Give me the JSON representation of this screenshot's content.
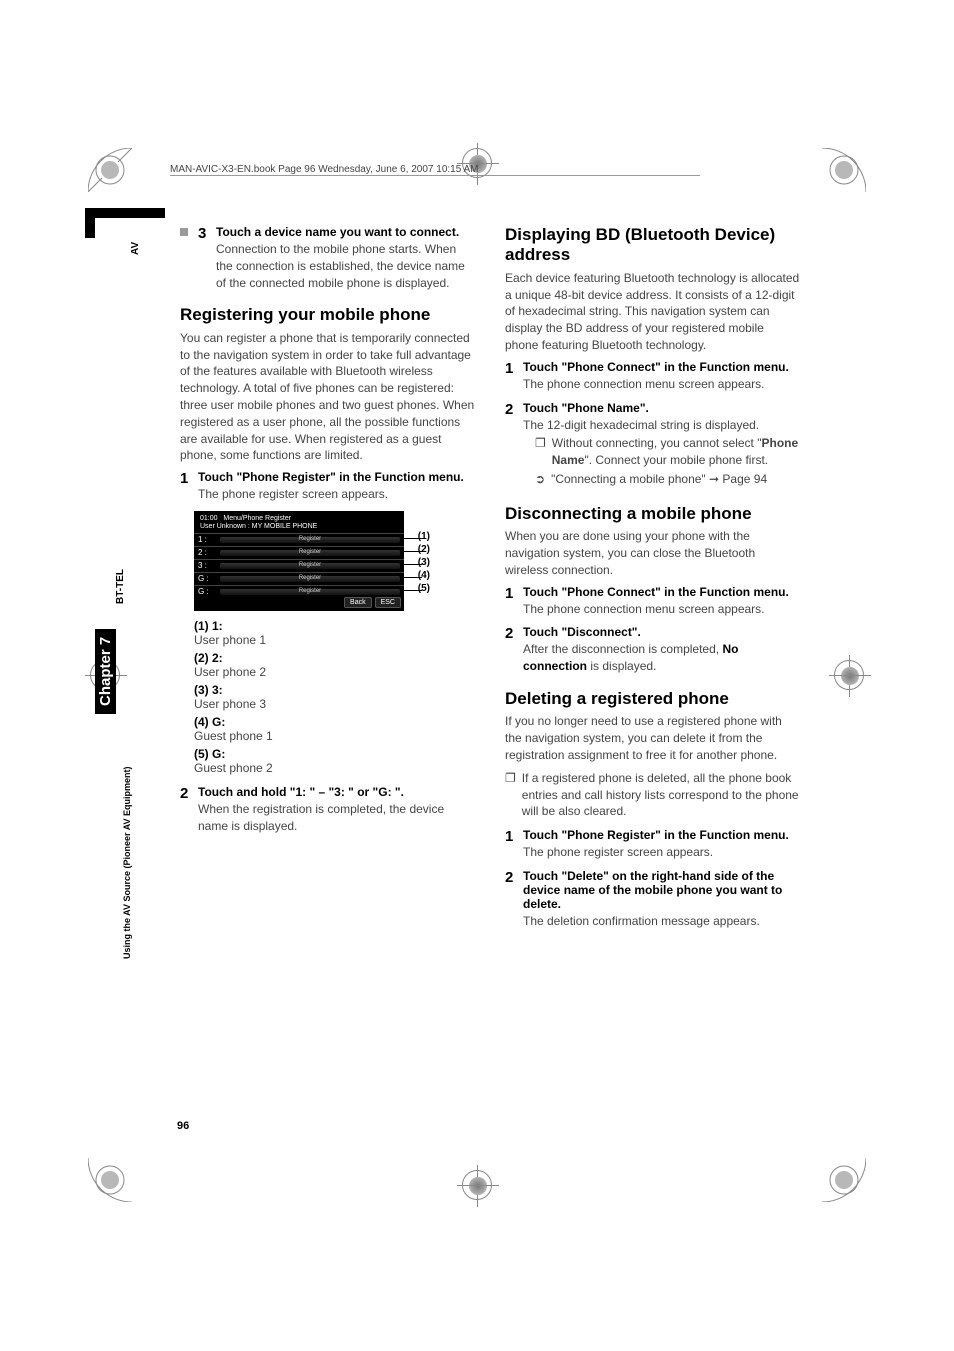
{
  "header": {
    "line": "MAN-AVIC-X3-EN.book  Page 96  Wednesday, June 6, 2007  10:15 AM"
  },
  "sidebar": {
    "av": "AV",
    "bttel": "BT-TEL",
    "chapter": "Chapter 7",
    "section": "Using the AV Source (Pioneer AV Equipment)"
  },
  "page_number": "96",
  "left": {
    "step3": {
      "num": "3",
      "title": "Touch a device name you want to connect.",
      "text": "Connection to the mobile phone starts. When the connection is established, the device name of the connected mobile phone is displayed."
    },
    "h_register": "Registering your mobile phone",
    "register_para": "You can register a phone that is temporarily connected to the navigation system in order to take full advantage of the features available with Bluetooth wireless technology. A total of five phones can be registered: three user mobile phones and two guest phones. When registered as a user phone, all the possible functions are available for use. When registered as a guest phone, some functions are limited.",
    "step1": {
      "num": "1",
      "title": "Touch \"Phone Register\" in the Function menu.",
      "text": "The phone register screen appears."
    },
    "screenshot": {
      "time": "01:00",
      "title": "Menu/Phone Register",
      "subtitle": "User Unknown : MY MOBILE PHONE",
      "rows": [
        {
          "label": "1 :",
          "callout": "(1)"
        },
        {
          "label": "2 :",
          "callout": "(2)"
        },
        {
          "label": "3 :",
          "callout": "(3)"
        },
        {
          "label": "G :",
          "callout": "(4)"
        },
        {
          "label": "G :",
          "callout": "(5)"
        }
      ],
      "register_btn": "Register",
      "back": "Back",
      "esc": "ESC"
    },
    "legend": [
      {
        "label": "(1) 1:",
        "text": "User phone 1"
      },
      {
        "label": "(2) 2:",
        "text": "User phone 2"
      },
      {
        "label": "(3) 3:",
        "text": "User phone 3"
      },
      {
        "label": "(4) G:",
        "text": "Guest phone 1"
      },
      {
        "label": "(5) G:",
        "text": "Guest phone 2"
      }
    ],
    "step2": {
      "num": "2",
      "title": "Touch and hold \"1: \" – \"3: \" or \"G: \".",
      "text": "When the registration is completed, the device name is displayed."
    }
  },
  "right": {
    "h_bd": "Displaying BD (Bluetooth Device) address",
    "bd_para": "Each device featuring Bluetooth technology is allocated a unique 48-bit device address. It consists of a 12-digit of hexadecimal string. This navigation system can display the BD address of your registered mobile phone featuring Bluetooth technology.",
    "bd_step1": {
      "num": "1",
      "title": "Touch \"Phone Connect\" in the Function menu.",
      "text": "The phone connection menu screen appears."
    },
    "bd_step2": {
      "num": "2",
      "title": "Touch \"Phone Name\".",
      "text": "The 12-digit hexadecimal string is displayed.",
      "bullet1_a": "Without connecting, you cannot select \"",
      "bullet1_b": "Phone Name",
      "bullet1_c": "\". Connect your mobile phone first.",
      "bullet2": "\"Connecting a mobile phone\" ➞ Page 94"
    },
    "h_disc": "Disconnecting a mobile phone",
    "disc_para": "When you are done using your phone with the navigation system, you can close the Bluetooth wireless connection.",
    "disc_step1": {
      "num": "1",
      "title": "Touch \"Phone Connect\" in the Function menu.",
      "text": "The phone connection menu screen appears."
    },
    "disc_step2": {
      "num": "2",
      "title": "Touch \"Disconnect\".",
      "text_a": "After the disconnection is completed, ",
      "text_b": "No connection",
      "text_c": " is displayed."
    },
    "h_del": "Deleting a registered phone",
    "del_para": "If you no longer need to use a registered phone with the navigation system, you can delete it from the registration assignment to free it for another phone.",
    "del_bullet": "If a registered phone is deleted, all the phone book entries and call history lists correspond to the phone will be also cleared.",
    "del_step1": {
      "num": "1",
      "title": "Touch \"Phone Register\" in the Function menu.",
      "text": "The phone register screen appears."
    },
    "del_step2": {
      "num": "2",
      "title": "Touch \"Delete\" on the right-hand side of the device name of the mobile phone you want to delete.",
      "text": "The deletion confirmation message appears."
    }
  }
}
